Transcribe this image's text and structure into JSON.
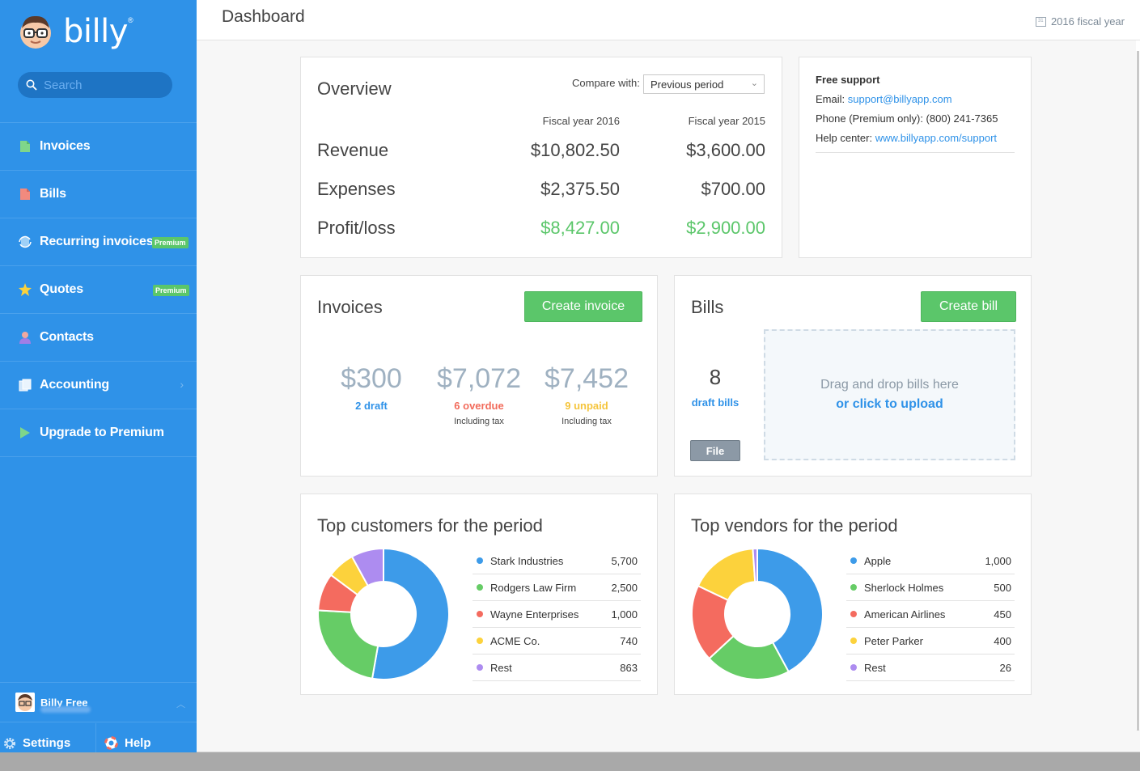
{
  "app": {
    "logo_text": "billy",
    "logo_mark": "®"
  },
  "search": {
    "placeholder": "Search"
  },
  "sidebar": {
    "items": [
      {
        "label": "Invoices",
        "icon": "invoice-icon",
        "color": "#7fd68a"
      },
      {
        "label": "Bills",
        "icon": "bill-icon",
        "color": "#f28a7e"
      },
      {
        "label": "Recurring invoices",
        "icon": "recurring-icon",
        "badge": "Premium"
      },
      {
        "label": "Quotes",
        "icon": "quote-star-icon",
        "badge": "Premium"
      },
      {
        "label": "Contacts",
        "icon": "contact-person-icon"
      },
      {
        "label": "Accounting",
        "icon": "accounting-icon"
      },
      {
        "label": "Upgrade to Premium",
        "icon": "play-flag-icon"
      }
    ],
    "user": {
      "name": "Billy Free"
    },
    "bottom": {
      "settings": "Settings",
      "help": "Help"
    }
  },
  "header": {
    "title": "Dashboard",
    "fiscal_year": "2016 fiscal year"
  },
  "overview": {
    "title": "Overview",
    "compare_label": "Compare with:",
    "compare_value": "Previous period",
    "col1": "Fiscal year 2016",
    "col2": "Fiscal year 2015",
    "rows": [
      {
        "label": "Revenue",
        "v1": "$10,802.50",
        "v2": "$3,600.00"
      },
      {
        "label": "Expenses",
        "v1": "$2,375.50",
        "v2": "$700.00"
      },
      {
        "label": "Profit/loss",
        "v1": "$8,427.00",
        "v2": "$2,900.00"
      }
    ]
  },
  "support": {
    "title": "Free support",
    "email_label": "Email:",
    "email": "support@billyapp.com",
    "phone": "Phone (Premium only): (800) 241-7365",
    "help_label": "Help center:",
    "help_url": "www.billyapp.com/support"
  },
  "invoices": {
    "title": "Invoices",
    "create": "Create invoice",
    "stats": [
      {
        "amount": "$300",
        "label": "2 draft",
        "sub": ""
      },
      {
        "amount": "$7,072",
        "label": "6 overdue",
        "sub": "Including tax"
      },
      {
        "amount": "$7,452",
        "label": "9 unpaid",
        "sub": "Including tax"
      }
    ]
  },
  "bills": {
    "title": "Bills",
    "create": "Create bill",
    "count": "8",
    "count_label": "draft bills",
    "file": "File",
    "drop_text": "Drag and drop bills here",
    "drop_link": "or click to upload"
  },
  "customers": {
    "title": "Top customers for the period",
    "items": [
      {
        "name": "Stark Industries",
        "value": "5,700",
        "num": 5700,
        "color": "#3d9be9"
      },
      {
        "name": "Rodgers Law Firm",
        "value": "2,500",
        "num": 2500,
        "color": "#66cc66"
      },
      {
        "name": "Wayne Enterprises",
        "value": "1,000",
        "num": 1000,
        "color": "#f46b5f"
      },
      {
        "name": "ACME Co.",
        "value": "740",
        "num": 740,
        "color": "#fcd23c"
      },
      {
        "name": "Rest",
        "value": "863",
        "num": 863,
        "color": "#ad8cf0"
      }
    ]
  },
  "vendors": {
    "title": "Top vendors for the period",
    "items": [
      {
        "name": "Apple",
        "value": "1,000",
        "num": 1000,
        "color": "#3d9be9"
      },
      {
        "name": "Sherlock Holmes",
        "value": "500",
        "num": 500,
        "color": "#66cc66"
      },
      {
        "name": "American Airlines",
        "value": "450",
        "num": 450,
        "color": "#f46b5f"
      },
      {
        "name": "Peter Parker",
        "value": "400",
        "num": 400,
        "color": "#fcd23c"
      },
      {
        "name": "Rest",
        "value": "26",
        "num": 26,
        "color": "#ad8cf0"
      }
    ]
  }
}
